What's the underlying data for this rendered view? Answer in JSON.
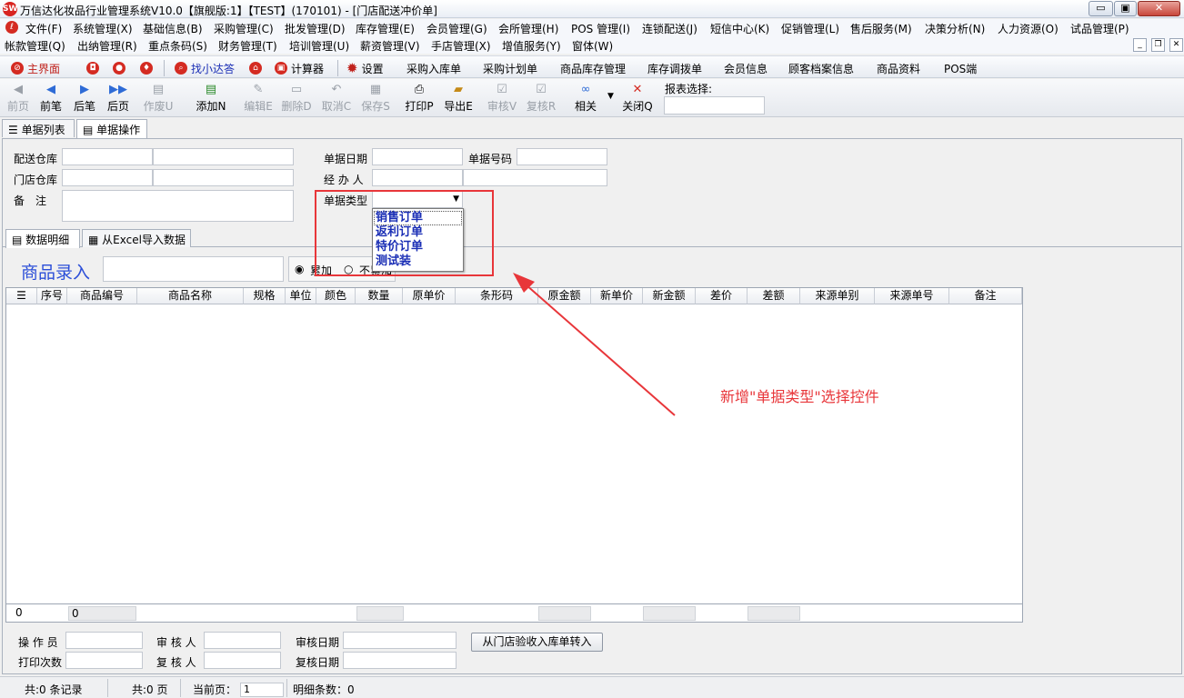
{
  "window": {
    "logo_text": "SW",
    "title": "万信达化妆品行业管理系统V10.0【旗舰版:1】【TEST】(170101) - [门店配送冲价单]",
    "btn_min": "▭",
    "btn_max": "▣",
    "btn_close": "✕"
  },
  "menu1": [
    "文件(F)",
    "系统管理(X)",
    "基础信息(B)",
    "采购管理(C)",
    "批发管理(D)",
    "库存管理(E)",
    "会员管理(G)",
    "会所管理(H)",
    "POS 管理(I)",
    "连锁配送(J)",
    "短信中心(K)",
    "促销管理(L)",
    "售后服务(M)",
    "决策分析(N)",
    "人力资源(O)",
    "试品管理(P)"
  ],
  "menu2": [
    "帐款管理(Q)",
    "出纳管理(R)",
    "重点条码(S)",
    "财务管理(T)",
    "培训管理(U)",
    "薪资管理(V)",
    "手店管理(X)",
    "增值服务(Y)",
    "窗体(W)"
  ],
  "mdi": {
    "min": "_",
    "restore": "❐",
    "close": "✕"
  },
  "quickbar": {
    "home": "主界面",
    "find": "找小达答",
    "calc": "计算器",
    "settings": "设置",
    "links": [
      "采购入库单",
      "采购计划单",
      "商品库存管理",
      "库存调拨单",
      "会员信息",
      "顾客档案信息",
      "商品资料",
      "POS端"
    ]
  },
  "toolbar": {
    "first": "前页",
    "prev": "前笔",
    "next": "后笔",
    "last": "后页",
    "void": "作废U",
    "add": "添加N",
    "edit": "编辑E",
    "delete": "删除D",
    "cancel": "取消C",
    "save": "保存S",
    "print": "打印P",
    "export": "导出E",
    "audit": "审核V",
    "reaudit": "复核R",
    "related": "相关",
    "close": "关闭Q",
    "report_select": "报表选择:"
  },
  "tabs": {
    "list": "单据列表",
    "operate": "单据操作"
  },
  "form": {
    "warehouse": "配送仓库",
    "store_wh": "门店仓库",
    "remark": "备　注",
    "date": "单据日期",
    "number": "单据号码",
    "handler": "经 办 人",
    "doc_type": "单据类型",
    "doc_type_value": ""
  },
  "doc_type_options": [
    "销售订单",
    "返利订单",
    "特价订单",
    "测试装"
  ],
  "subtabs": {
    "detail": "数据明细",
    "excel": "从Excel导入数据"
  },
  "entry": {
    "label": "商品录入",
    "opt_add": "累加",
    "opt_noadd": "不累加"
  },
  "grid": {
    "columns": [
      "序号",
      "商品编号",
      "商品名称",
      "规格",
      "单位",
      "颜色",
      "数量",
      "原单价",
      "条形码",
      "原金额",
      "新单价",
      "新金额",
      "差价",
      "差额",
      "来源单别",
      "来源单号",
      "备注"
    ],
    "foot_count": "0",
    "foot_value": "0"
  },
  "annotation": "新增\"单据类型\"选择控件",
  "bottom": {
    "operator": "操 作 员",
    "auditor": "审 核 人",
    "audit_date": "审核日期",
    "print_count": "打印次数",
    "reauditor": "复 核 人",
    "reaudit_date": "复核日期",
    "transfer_btn": "从门店验收入库单转入"
  },
  "status": {
    "records": "共:0 条记录",
    "pages": "共:0 页",
    "current_label": "当前页：",
    "current_value": "1",
    "detail_count": "明细条数：0"
  },
  "colors": {
    "accent_red": "#e8363a",
    "option_blue": "#1a2eb5",
    "entry_blue": "#2b4ed8"
  }
}
